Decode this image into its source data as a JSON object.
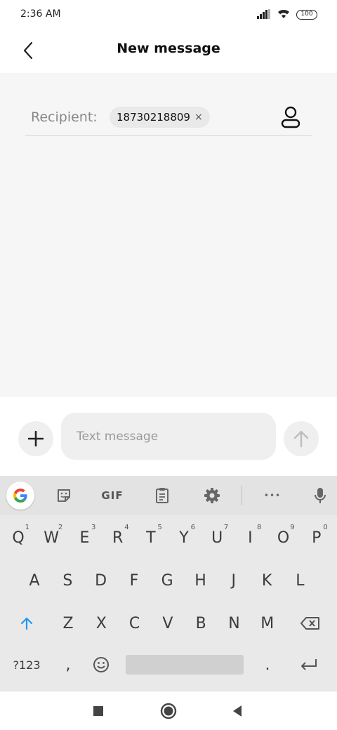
{
  "status_bar": {
    "time": "2:36 AM",
    "battery": "100"
  },
  "header": {
    "title": "New message"
  },
  "recipient": {
    "label": "Recipient:",
    "chip_text": "18730218809",
    "chip_close": "×"
  },
  "composer": {
    "placeholder": "Text message"
  },
  "keyboard": {
    "toolbar": {
      "gif_label": "GIF",
      "more_label": "•••"
    },
    "row1": [
      {
        "k": "Q",
        "h": "1"
      },
      {
        "k": "W",
        "h": "2"
      },
      {
        "k": "E",
        "h": "3"
      },
      {
        "k": "R",
        "h": "4"
      },
      {
        "k": "T",
        "h": "5"
      },
      {
        "k": "Y",
        "h": "6"
      },
      {
        "k": "U",
        "h": "7"
      },
      {
        "k": "I",
        "h": "8"
      },
      {
        "k": "O",
        "h": "9"
      },
      {
        "k": "P",
        "h": "0"
      }
    ],
    "row2": [
      "A",
      "S",
      "D",
      "F",
      "G",
      "H",
      "J",
      "K",
      "L"
    ],
    "row3": [
      "Z",
      "X",
      "C",
      "V",
      "B",
      "N",
      "M"
    ],
    "row4": {
      "symbols": "?123",
      "comma": ",",
      "period": "."
    }
  },
  "colors": {
    "accent": "#1a73e8",
    "shift_arrow": "#2196f3"
  }
}
